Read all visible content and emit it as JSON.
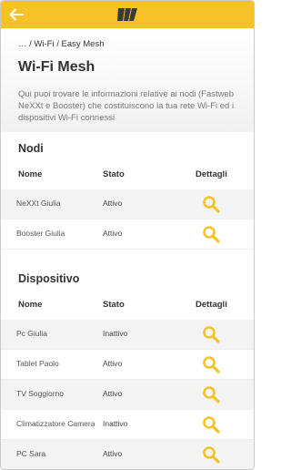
{
  "header": {
    "back_icon": "arrow-left-icon",
    "logo_icon": "fastweb-logo",
    "bar_color": "#f6c225"
  },
  "breadcrumb": {
    "ellipsis": "…",
    "sep1": "/",
    "item1": "Wi-Fi",
    "sep2": "/",
    "item2": "Easy Mesh"
  },
  "page": {
    "title": "Wi-Fi Mesh",
    "intro": "Qui puoi trovare le informazioni relative ai nodi (Fastweb NeXXt e Booster) che costituiscono la tua rete Wi-Fi ed i dispositivi Wi-Fi connessi"
  },
  "nodi": {
    "title": "Nodi",
    "columns": {
      "name": "Nome",
      "status": "Stato",
      "details": "Dettagli"
    },
    "rows": [
      {
        "name": "NeXXt Giulia",
        "status": "Attivo"
      },
      {
        "name": "Booster Giulia",
        "status": "Attivo"
      }
    ]
  },
  "dispositivo": {
    "title": "Dispositivo",
    "columns": {
      "name": "Nome",
      "status": "Stato",
      "details": "Dettagli"
    },
    "rows": [
      {
        "name": "Pc Giulia",
        "status": "Inattivo"
      },
      {
        "name": "Tablet Paolo",
        "status": "Attivo"
      },
      {
        "name": "TV Soggiorno",
        "status": "Attivo"
      },
      {
        "name": "Climatizzatore Camera",
        "status": "Inattivo"
      },
      {
        "name": "PC Sara",
        "status": "Attivo"
      }
    ]
  },
  "icons": {
    "details_icon": "magnifier-icon",
    "accent": "#f6c225"
  }
}
